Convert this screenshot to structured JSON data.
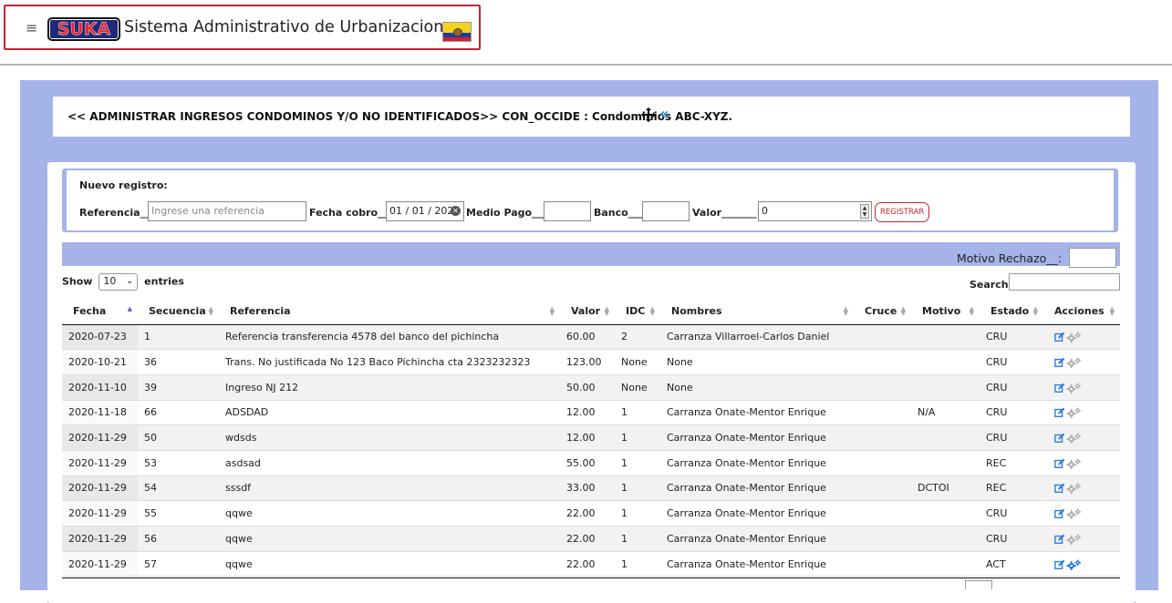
{
  "header": {
    "menu_icon": "hamburger-icon",
    "logo_text": "SUKA",
    "app_title": "Sistema Administrativo de Urbanizaciones",
    "flag_icon": "ecuador-flag-icon"
  },
  "page": {
    "title": "<< ADMINISTRAR INGRESOS CONDOMINOS Y/O NO IDENTIFICADOS>> CON_OCCIDE : Condominios ABC-XYZ.",
    "move_icon": "move-icon",
    "back_icon": "double-chevron-left-icon",
    "back_glyph": "«"
  },
  "new_record": {
    "title": "Nuevo registro:",
    "referencia_label": "Referencia___:",
    "referencia_placeholder": "Ingrese una referencia",
    "fecha_label": "Fecha cobro___:",
    "fecha_value": "01 / 01 / 2021",
    "medio_label": "Medio Pago___:",
    "medio_value": "",
    "banco_label": "Banco___:",
    "banco_value": "",
    "valor_label": "Valor_______:",
    "valor_value": "0",
    "register_button": "REGISTRAR"
  },
  "filter": {
    "motivo_label": "Motivo Rechazo__:",
    "motivo_value": ""
  },
  "table_controls": {
    "show_label": "Show",
    "entries_value": "10",
    "entries_label": "entries",
    "search_label": "Search:",
    "search_value": ""
  },
  "table": {
    "columns": [
      "Fecha",
      "Secuencia",
      "Referencia",
      "Valor",
      "IDC",
      "Nombres",
      "Cruce",
      "Motivo",
      "Estado",
      "Acciones"
    ],
    "sorted_column": "Fecha",
    "rows": [
      {
        "fecha": "2020-07-23",
        "secuencia": "1",
        "referencia": "Referencia transferencia 4578 del banco del pichincha",
        "valor": "60.00",
        "idc": "2",
        "nombres": "Carranza Villarroel-Carlos Daniel",
        "cruce": "",
        "motivo": "",
        "estado": "CRU",
        "gear_active": false
      },
      {
        "fecha": "2020-10-21",
        "secuencia": "36",
        "referencia": "Trans. No justificada No 123 Baco Pichincha cta 2323232323",
        "valor": "123.00",
        "idc": "None",
        "nombres": "None",
        "cruce": "",
        "motivo": "",
        "estado": "CRU",
        "gear_active": false
      },
      {
        "fecha": "2020-11-10",
        "secuencia": "39",
        "referencia": "Ingreso NJ 212",
        "valor": "50.00",
        "idc": "None",
        "nombres": "None",
        "cruce": "",
        "motivo": "",
        "estado": "CRU",
        "gear_active": false
      },
      {
        "fecha": "2020-11-18",
        "secuencia": "66",
        "referencia": "ADSDAD",
        "valor": "12.00",
        "idc": "1",
        "nombres": "Carranza Onate-Mentor Enrique",
        "cruce": "",
        "motivo": "N/A",
        "estado": "CRU",
        "gear_active": false
      },
      {
        "fecha": "2020-11-29",
        "secuencia": "50",
        "referencia": "wdsds",
        "valor": "12.00",
        "idc": "1",
        "nombres": "Carranza Onate-Mentor Enrique",
        "cruce": "",
        "motivo": "",
        "estado": "CRU",
        "gear_active": false
      },
      {
        "fecha": "2020-11-29",
        "secuencia": "53",
        "referencia": "asdsad",
        "valor": "55.00",
        "idc": "1",
        "nombres": "Carranza Onate-Mentor Enrique",
        "cruce": "",
        "motivo": "",
        "estado": "REC",
        "gear_active": false
      },
      {
        "fecha": "2020-11-29",
        "secuencia": "54",
        "referencia": "sssdf",
        "valor": "33.00",
        "idc": "1",
        "nombres": "Carranza Onate-Mentor Enrique",
        "cruce": "",
        "motivo": "DCTOI",
        "estado": "REC",
        "gear_active": false
      },
      {
        "fecha": "2020-11-29",
        "secuencia": "55",
        "referencia": "qqwe",
        "valor": "22.00",
        "idc": "1",
        "nombres": "Carranza Onate-Mentor Enrique",
        "cruce": "",
        "motivo": "",
        "estado": "CRU",
        "gear_active": false
      },
      {
        "fecha": "2020-11-29",
        "secuencia": "56",
        "referencia": "qqwe",
        "valor": "22.00",
        "idc": "1",
        "nombres": "Carranza Onate-Mentor Enrique",
        "cruce": "",
        "motivo": "",
        "estado": "CRU",
        "gear_active": false
      },
      {
        "fecha": "2020-11-29",
        "secuencia": "57",
        "referencia": "qqwe",
        "valor": "22.00",
        "idc": "1",
        "nombres": "Carranza Onate-Mentor Enrique",
        "cruce": "",
        "motivo": "",
        "estado": "ACT",
        "gear_active": true
      }
    ]
  },
  "colors": {
    "panel_blue": "#a4b4e8",
    "accent_red": "#c0272d",
    "icon_blue": "#2a7be4",
    "icon_gray": "#b0b0b0"
  }
}
